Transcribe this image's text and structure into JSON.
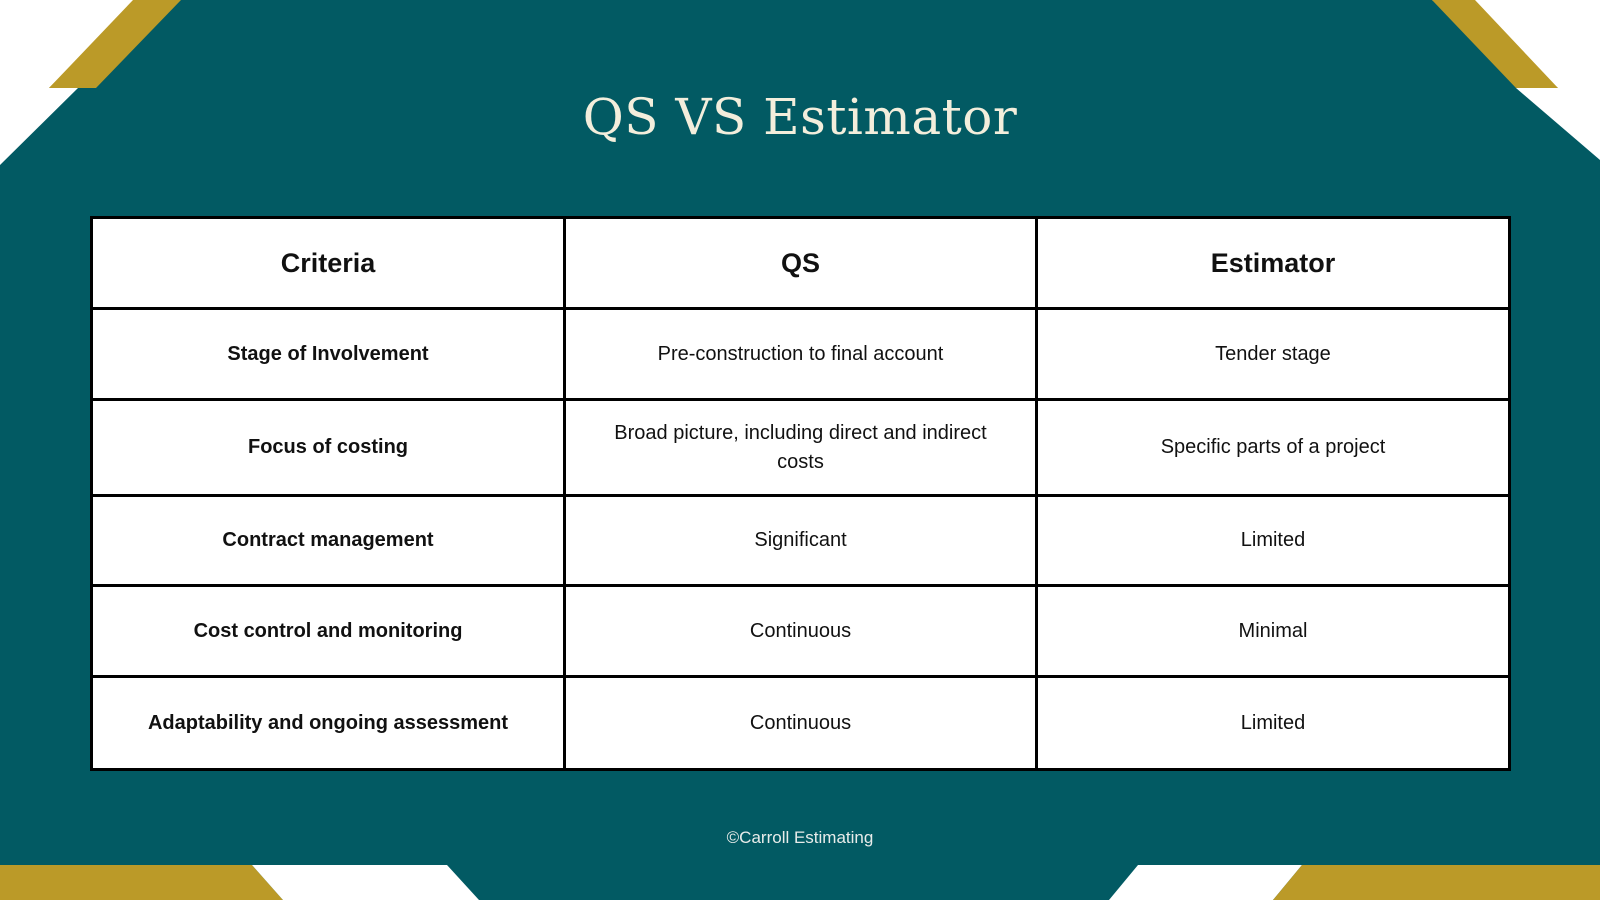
{
  "title": "QS VS Estimator",
  "colors": {
    "background": "#025A63",
    "accent": "#BB9A28",
    "title_text": "#F3EEDC"
  },
  "table": {
    "headers": [
      "Criteria",
      "QS",
      "Estimator"
    ],
    "rows": [
      {
        "criteria": "Stage of Involvement",
        "qs": "Pre-construction to final account",
        "estimator": "Tender stage"
      },
      {
        "criteria": "Focus of costing",
        "qs": "Broad picture, including direct and indirect costs",
        "estimator": "Specific parts of a project"
      },
      {
        "criteria": "Contract management",
        "qs": "Significant",
        "estimator": "Limited"
      },
      {
        "criteria": "Cost control and monitoring",
        "qs": "Continuous",
        "estimator": "Minimal"
      },
      {
        "criteria": "Adaptability and ongoing assessment",
        "qs": "Continuous",
        "estimator": "Limited"
      }
    ]
  },
  "footer": "©Carroll Estimating"
}
